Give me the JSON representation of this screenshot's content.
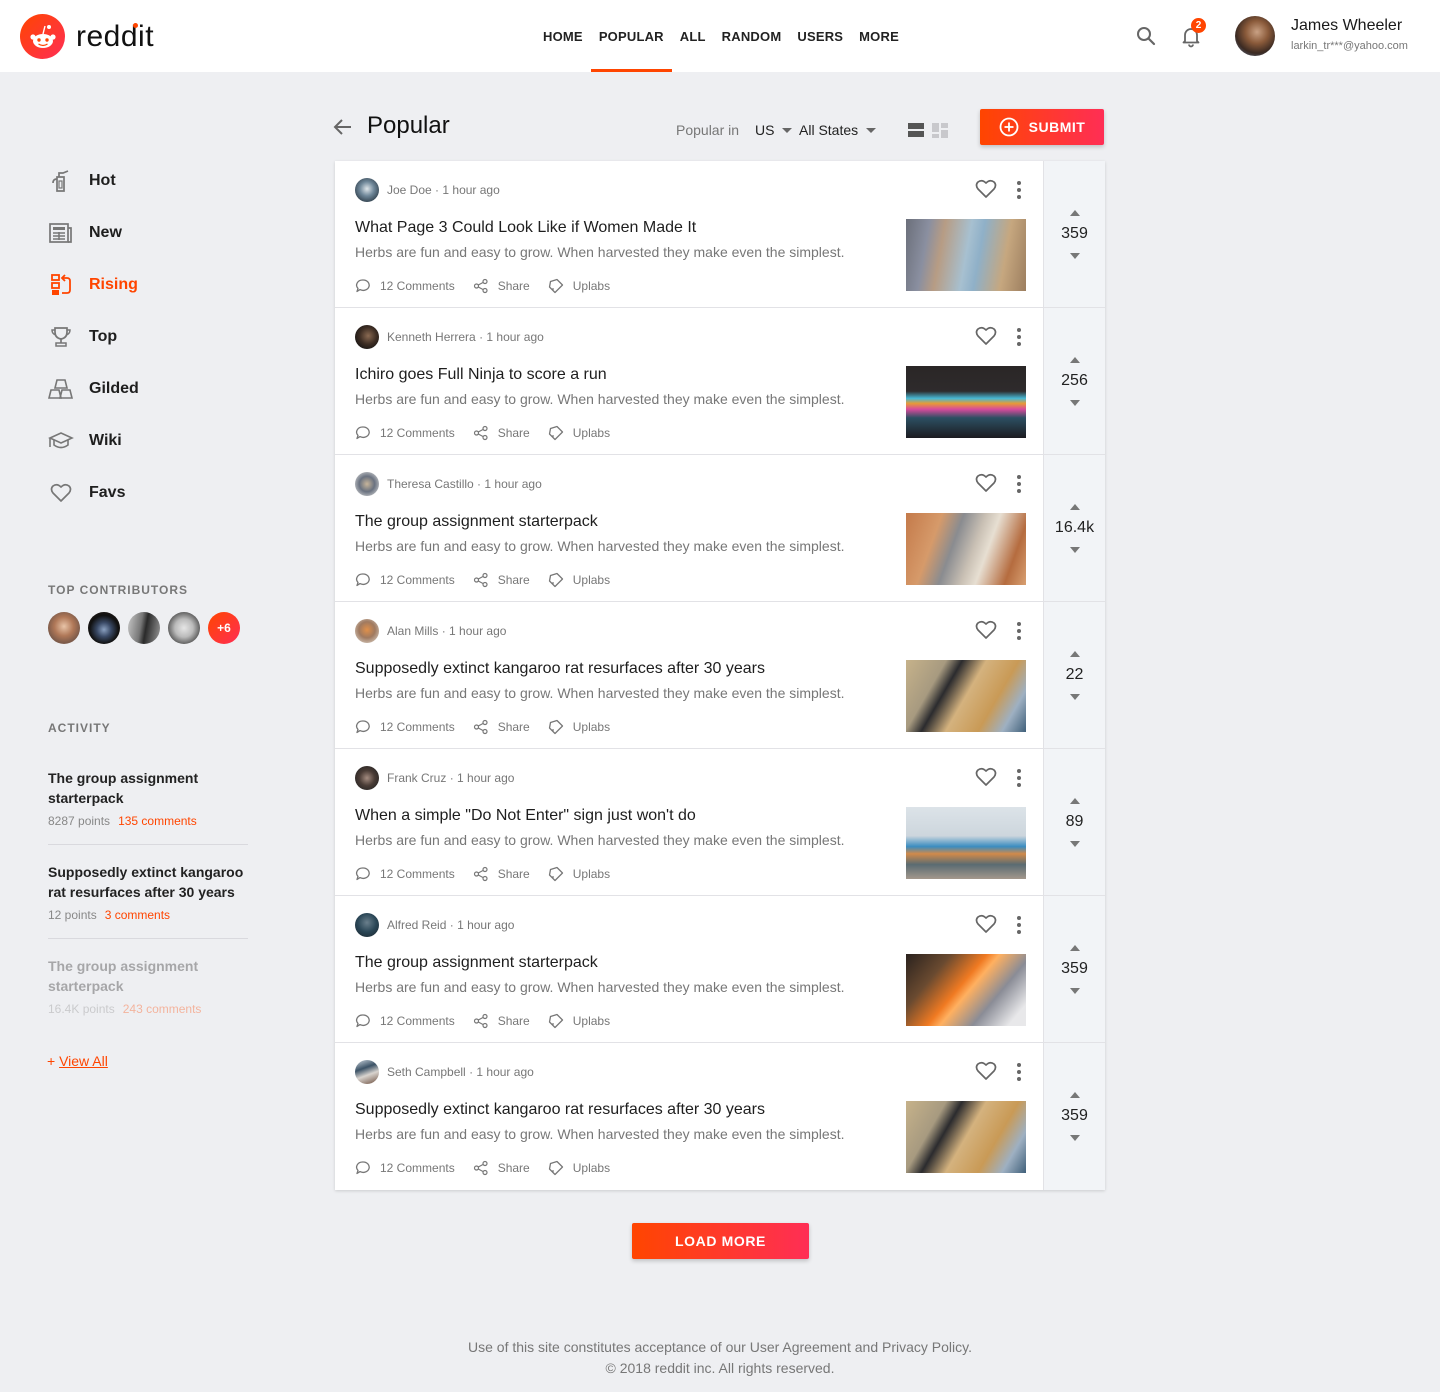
{
  "brand": {
    "name": "reddit",
    "accent": "#ff4500",
    "accent_end": "#ff2e55"
  },
  "topnav": [
    {
      "label": "HOME",
      "active": false
    },
    {
      "label": "POPULAR",
      "active": true
    },
    {
      "label": "ALL",
      "active": false
    },
    {
      "label": "RANDOM",
      "active": false
    },
    {
      "label": "USERS",
      "active": false
    },
    {
      "label": "MORE",
      "active": false
    }
  ],
  "header": {
    "search_icon": "search-icon",
    "notifications": {
      "icon": "bell-icon",
      "count": "2"
    },
    "user": {
      "name": "James Wheeler",
      "email": "larkin_tr***@yahoo.com"
    }
  },
  "sidebar": {
    "items": [
      {
        "label": "Hot",
        "icon": "fire-extinguisher-icon",
        "active": false
      },
      {
        "label": "New",
        "icon": "newspaper-icon",
        "active": false
      },
      {
        "label": "Rising",
        "icon": "rising-icon",
        "active": true
      },
      {
        "label": "Top",
        "icon": "trophy-icon",
        "active": false
      },
      {
        "label": "Gilded",
        "icon": "gold-bars-icon",
        "active": false
      },
      {
        "label": "Wiki",
        "icon": "graduation-cap-icon",
        "active": false
      },
      {
        "label": "Favs",
        "icon": "heart-icon",
        "active": false
      }
    ],
    "top_contributors": {
      "title": "TOP CONTRIBUTORS",
      "more": "+6"
    },
    "activity": {
      "title": "ACTIVITY",
      "items": [
        {
          "title": "The group assignment starterpack",
          "points": "8287 points",
          "comments": "135 comments"
        },
        {
          "title": "Supposedly extinct kangaroo rat resurfaces after 30 years",
          "points": "12 points",
          "comments": "3 comments"
        },
        {
          "title": "The group assignment starterpack",
          "points": "16.4K points",
          "comments": "243 comments"
        }
      ],
      "view_all": "View All",
      "view_all_prefix": "+ "
    }
  },
  "main": {
    "title": "Popular",
    "filter_label": "Popular in",
    "country": "US",
    "state": "All States",
    "submit_label": "SUBMIT",
    "load_more_label": "LOAD MORE"
  },
  "posts": [
    {
      "author": "Joe Doe",
      "time": "1 hour ago",
      "title": "What Page 3 Could Look Like if Women Made It",
      "desc": "Herbs are fun and easy to grow. When harvested they make even the simplest.",
      "comments": "12 Comments",
      "share": "Share",
      "uplabs": "Uplabs",
      "votes": "359"
    },
    {
      "author": "Kenneth Herrera",
      "time": "1 hour ago",
      "title": "Ichiro goes Full Ninja to score a run",
      "desc": "Herbs are fun and easy to grow. When harvested they make even the simplest.",
      "comments": "12 Comments",
      "share": "Share",
      "uplabs": "Uplabs",
      "votes": "256"
    },
    {
      "author": "Theresa Castillo",
      "time": "1 hour ago",
      "title": "The group assignment starterpack",
      "desc": "Herbs are fun and easy to grow. When harvested they make even the simplest.",
      "comments": "12 Comments",
      "share": "Share",
      "uplabs": "Uplabs",
      "votes": "16.4k"
    },
    {
      "author": "Alan Mills",
      "time": "1 hour ago",
      "title": "Supposedly extinct kangaroo rat resurfaces after 30 years",
      "desc": "Herbs are fun and easy to grow. When harvested they make even the simplest.",
      "comments": "12 Comments",
      "share": "Share",
      "uplabs": "Uplabs",
      "votes": "22"
    },
    {
      "author": "Frank Cruz",
      "time": "1 hour ago",
      "title": "When a simple \"Do Not Enter\" sign just won't do",
      "desc": "Herbs are fun and easy to grow. When harvested they make even the simplest.",
      "comments": "12 Comments",
      "share": "Share",
      "uplabs": "Uplabs",
      "votes": "89"
    },
    {
      "author": "Alfred Reid",
      "time": "1 hour ago",
      "title": "The group assignment starterpack",
      "desc": "Herbs are fun and easy to grow. When harvested they make even the simplest.",
      "comments": "12 Comments",
      "share": "Share",
      "uplabs": "Uplabs",
      "votes": "359"
    },
    {
      "author": "Seth Campbell",
      "time": "1 hour ago",
      "title": "Supposedly extinct kangaroo rat resurfaces after 30 years",
      "desc": "Herbs are fun and easy to grow. When harvested they make even the simplest.",
      "comments": "12 Comments",
      "share": "Share",
      "uplabs": "Uplabs",
      "votes": "359"
    }
  ],
  "footer": {
    "line1": "Use of this site constitutes acceptance of our User Agreement and Privacy Policy.",
    "line2": "© 2018 reddit inc. All rights reserved."
  }
}
